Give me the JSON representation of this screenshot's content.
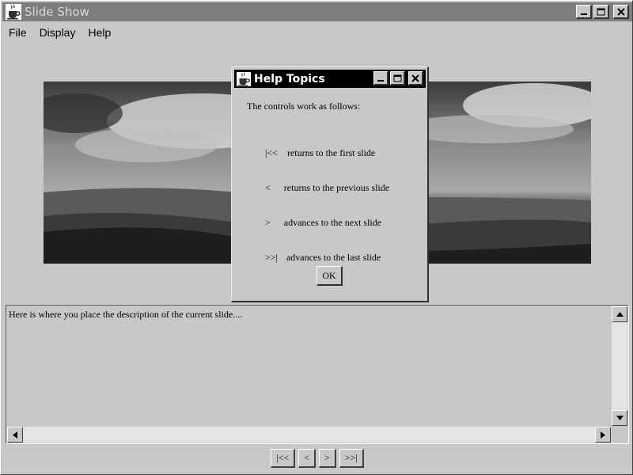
{
  "window": {
    "title": "Slide Show",
    "icon": "java-cup-icon",
    "minimize_icon": "minimize-icon",
    "maximize_icon": "maximize-icon",
    "close_icon": "close-icon"
  },
  "menu": {
    "items": [
      {
        "label": "File"
      },
      {
        "label": "Display"
      },
      {
        "label": "Help"
      }
    ]
  },
  "slide": {
    "image": "landscape-photo"
  },
  "description": {
    "text": "Here is where you place the description of the current slide...."
  },
  "nav": {
    "first": "|<<",
    "prev": "<",
    "next": ">",
    "last": ">>|"
  },
  "dialog": {
    "title": "Help Topics",
    "intro": "The controls work as follows:",
    "rows": [
      {
        "symbol": "|<<",
        "text": "returns to the first slide"
      },
      {
        "symbol": "<",
        "text": "returns to the previous slide"
      },
      {
        "symbol": ">",
        "text": "advances to the next slide"
      },
      {
        "symbol": ">>|",
        "text": "advances to the last slide"
      }
    ],
    "ok_label": "OK"
  },
  "colors": {
    "face": "#c8c8c8",
    "inactive_title": "#7d7d7d",
    "active_title": "#000000"
  }
}
